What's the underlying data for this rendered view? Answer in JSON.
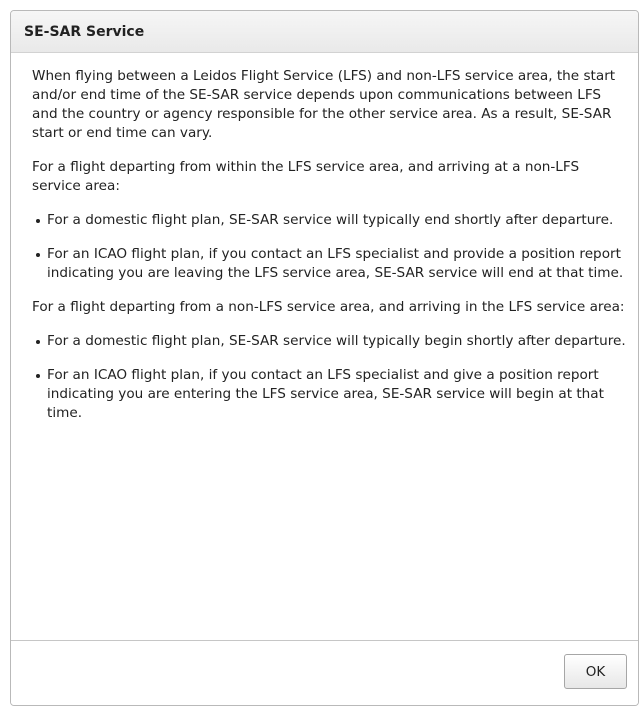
{
  "dialog": {
    "title": "SE-SAR Service",
    "paragraphs": [
      "When flying between a Leidos Flight Service (LFS) and non-LFS service area, the start and/or end time of the SE-SAR service depends upon communications between LFS and the country or agency responsible for the other service area. As a result, SE-SAR start or end time can vary.",
      "For a flight departing from within the LFS service area, and arriving at a non-LFS service area:",
      "For a flight departing from a non-LFS service area, and arriving in the LFS service area:"
    ],
    "departing_lfs_bullets": [
      "For a domestic flight plan, SE-SAR service will typically end shortly after departure.",
      "For an ICAO flight plan, if you contact an LFS specialist and provide a position report indicating you are leaving the LFS service area, SE-SAR service will end at that time."
    ],
    "arriving_lfs_bullets": [
      "For a domestic flight plan, SE-SAR service will typically begin shortly after departure.",
      "For an ICAO flight plan, if you contact an LFS specialist and give a position report indicating you are entering the LFS service area, SE-SAR service will begin at that time."
    ],
    "ok_label": "OK"
  }
}
